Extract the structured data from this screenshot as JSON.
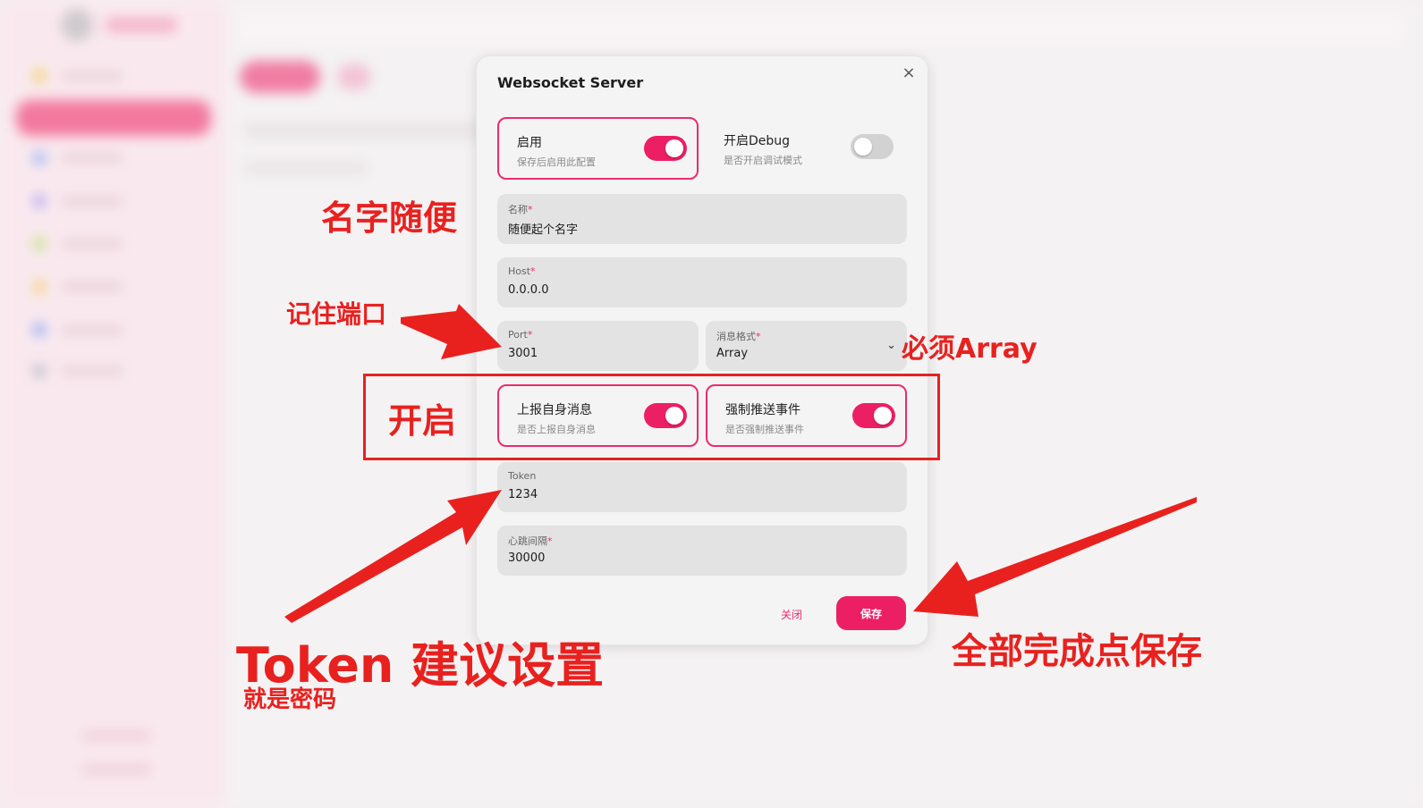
{
  "modal": {
    "title": "Websocket Server",
    "enable": {
      "label": "启用",
      "desc": "保存后启用此配置",
      "on": true
    },
    "debug": {
      "label": "开启Debug",
      "desc": "是否开启调试模式",
      "on": false
    },
    "name": {
      "label": "名称",
      "value": "随便起个名字"
    },
    "host": {
      "label": "Host",
      "value": "0.0.0.0"
    },
    "port": {
      "label": "Port",
      "value": "3001"
    },
    "format": {
      "label": "消息格式",
      "value": "Array"
    },
    "report_self": {
      "label": "上报自身消息",
      "desc": "是否上报自身消息",
      "on": true
    },
    "force_push": {
      "label": "强制推送事件",
      "desc": "是否强制推送事件",
      "on": true
    },
    "token": {
      "label": "Token",
      "value": "1234"
    },
    "heartbeat": {
      "label": "心跳间隔",
      "value": "30000"
    },
    "required_mark": "*",
    "close_label": "关闭",
    "save_label": "保存",
    "close_icon": "close-icon",
    "chevron_icon": "chevron-down-icon"
  },
  "annotations": {
    "name_hint": "名字随便",
    "port_hint": "记住端口",
    "format_hint": "必须Array",
    "enable_hint": "开启",
    "token_hint": "Token 建议设置",
    "token_sub": "就是密码",
    "save_hint": "全部完成点保存"
  },
  "colors": {
    "accent": "#ec1f64",
    "annotation": "#e8211f"
  }
}
